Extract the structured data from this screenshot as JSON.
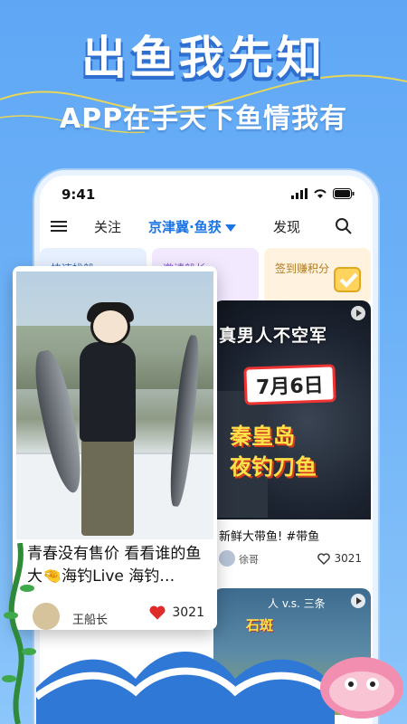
{
  "hero": {
    "title": "出鱼我先知",
    "subtitle": "APP在手天下鱼情我有"
  },
  "status_bar": {
    "time": "9:41",
    "icons": [
      "signal-icon",
      "wifi-icon",
      "battery-icon"
    ]
  },
  "nav": {
    "menu_icon": "menu-icon",
    "tabs": [
      {
        "label": "关注"
      },
      {
        "label": "京津冀·鱼获",
        "active": true
      },
      {
        "label": "发现"
      }
    ],
    "search_icon": "search-icon"
  },
  "shortcuts": [
    {
      "label": "快速找船"
    },
    {
      "label": "邀请船长"
    },
    {
      "label": "签到赚积分"
    }
  ],
  "featured_card": {
    "title": "青春没有售价 看看谁的鱼大🤏海钓Live 海钓…",
    "author": "王船长",
    "likes": "3021"
  },
  "right_card": {
    "poster_line1": "真男人不空军",
    "poster_date": "7月6日",
    "poster_place": "秦皇岛",
    "poster_event": "夜钓刀鱼",
    "title": "新鲜大带鱼! #带鱼",
    "author": "徐哥",
    "likes": "3021"
  },
  "right_card2": {
    "overlay_small": "人 v.s. 三条",
    "overlay_text": "石斑"
  },
  "colors": {
    "background": "#6eb2f7",
    "accent": "#1b74e4",
    "like_red": "#e02b2b"
  }
}
